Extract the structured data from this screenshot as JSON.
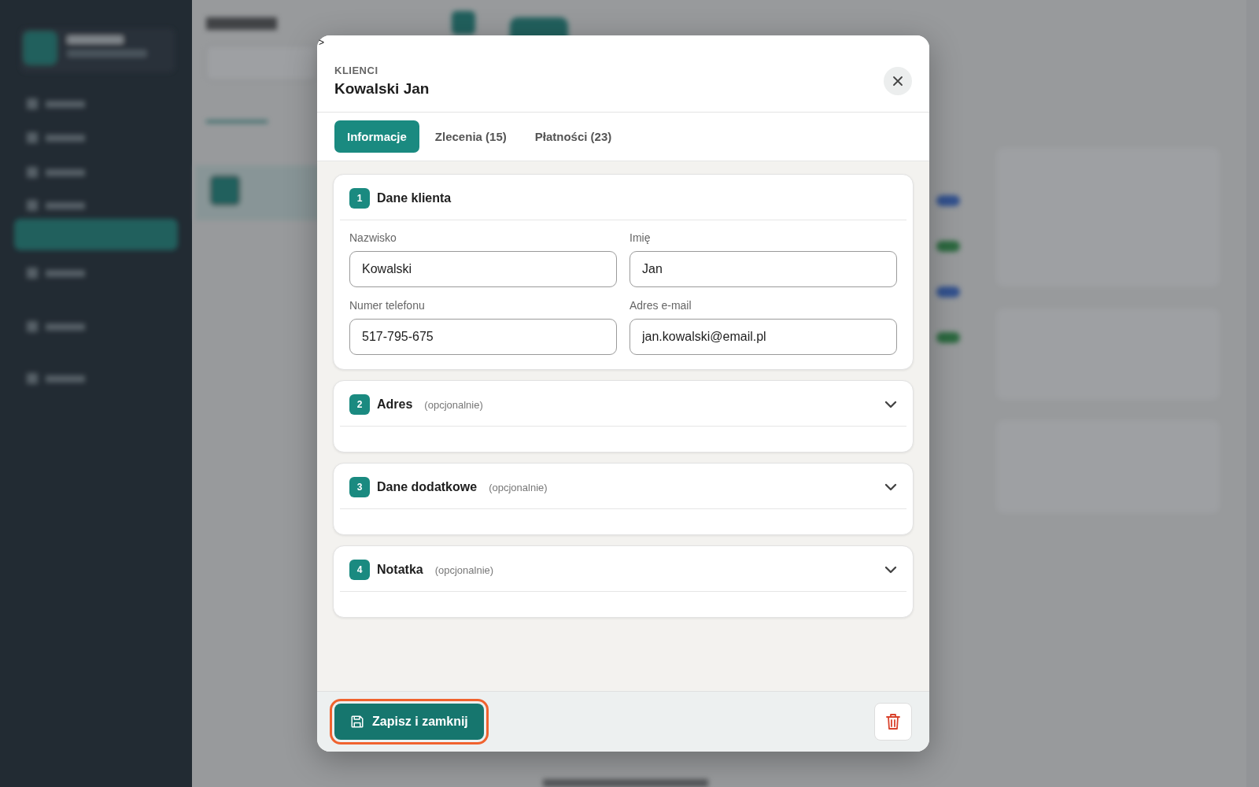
{
  "stray_mark": ">",
  "modal": {
    "eyebrow": "KLIENCI",
    "title": "Kowalski Jan",
    "tabs": [
      {
        "label": "Informacje",
        "selected": true
      },
      {
        "label": "Zlecenia (15)",
        "selected": false
      },
      {
        "label": "Płatności (23)",
        "selected": false
      }
    ],
    "sections": [
      {
        "number": "1",
        "title": "Dane klienta",
        "expanded": true,
        "fields": [
          {
            "label": "Nazwisko",
            "value": "Kowalski"
          },
          {
            "label": "Imię",
            "value": "Jan"
          },
          {
            "label": "Numer telefonu",
            "value": "517-795-675"
          },
          {
            "label": "Adres e-mail",
            "value": "jan.kowalski@email.pl"
          }
        ]
      },
      {
        "number": "2",
        "title": "Adres",
        "hint": "(opcjonalnie)",
        "expanded": false
      },
      {
        "number": "3",
        "title": "Dane dodatkowe",
        "hint": "(opcjonalnie)",
        "expanded": false
      },
      {
        "number": "4",
        "title": "Notatka",
        "hint": "(opcjonalnie)",
        "expanded": false
      }
    ],
    "save_button": {
      "label": "Zapisz i zamknij",
      "focused": true
    }
  }
}
